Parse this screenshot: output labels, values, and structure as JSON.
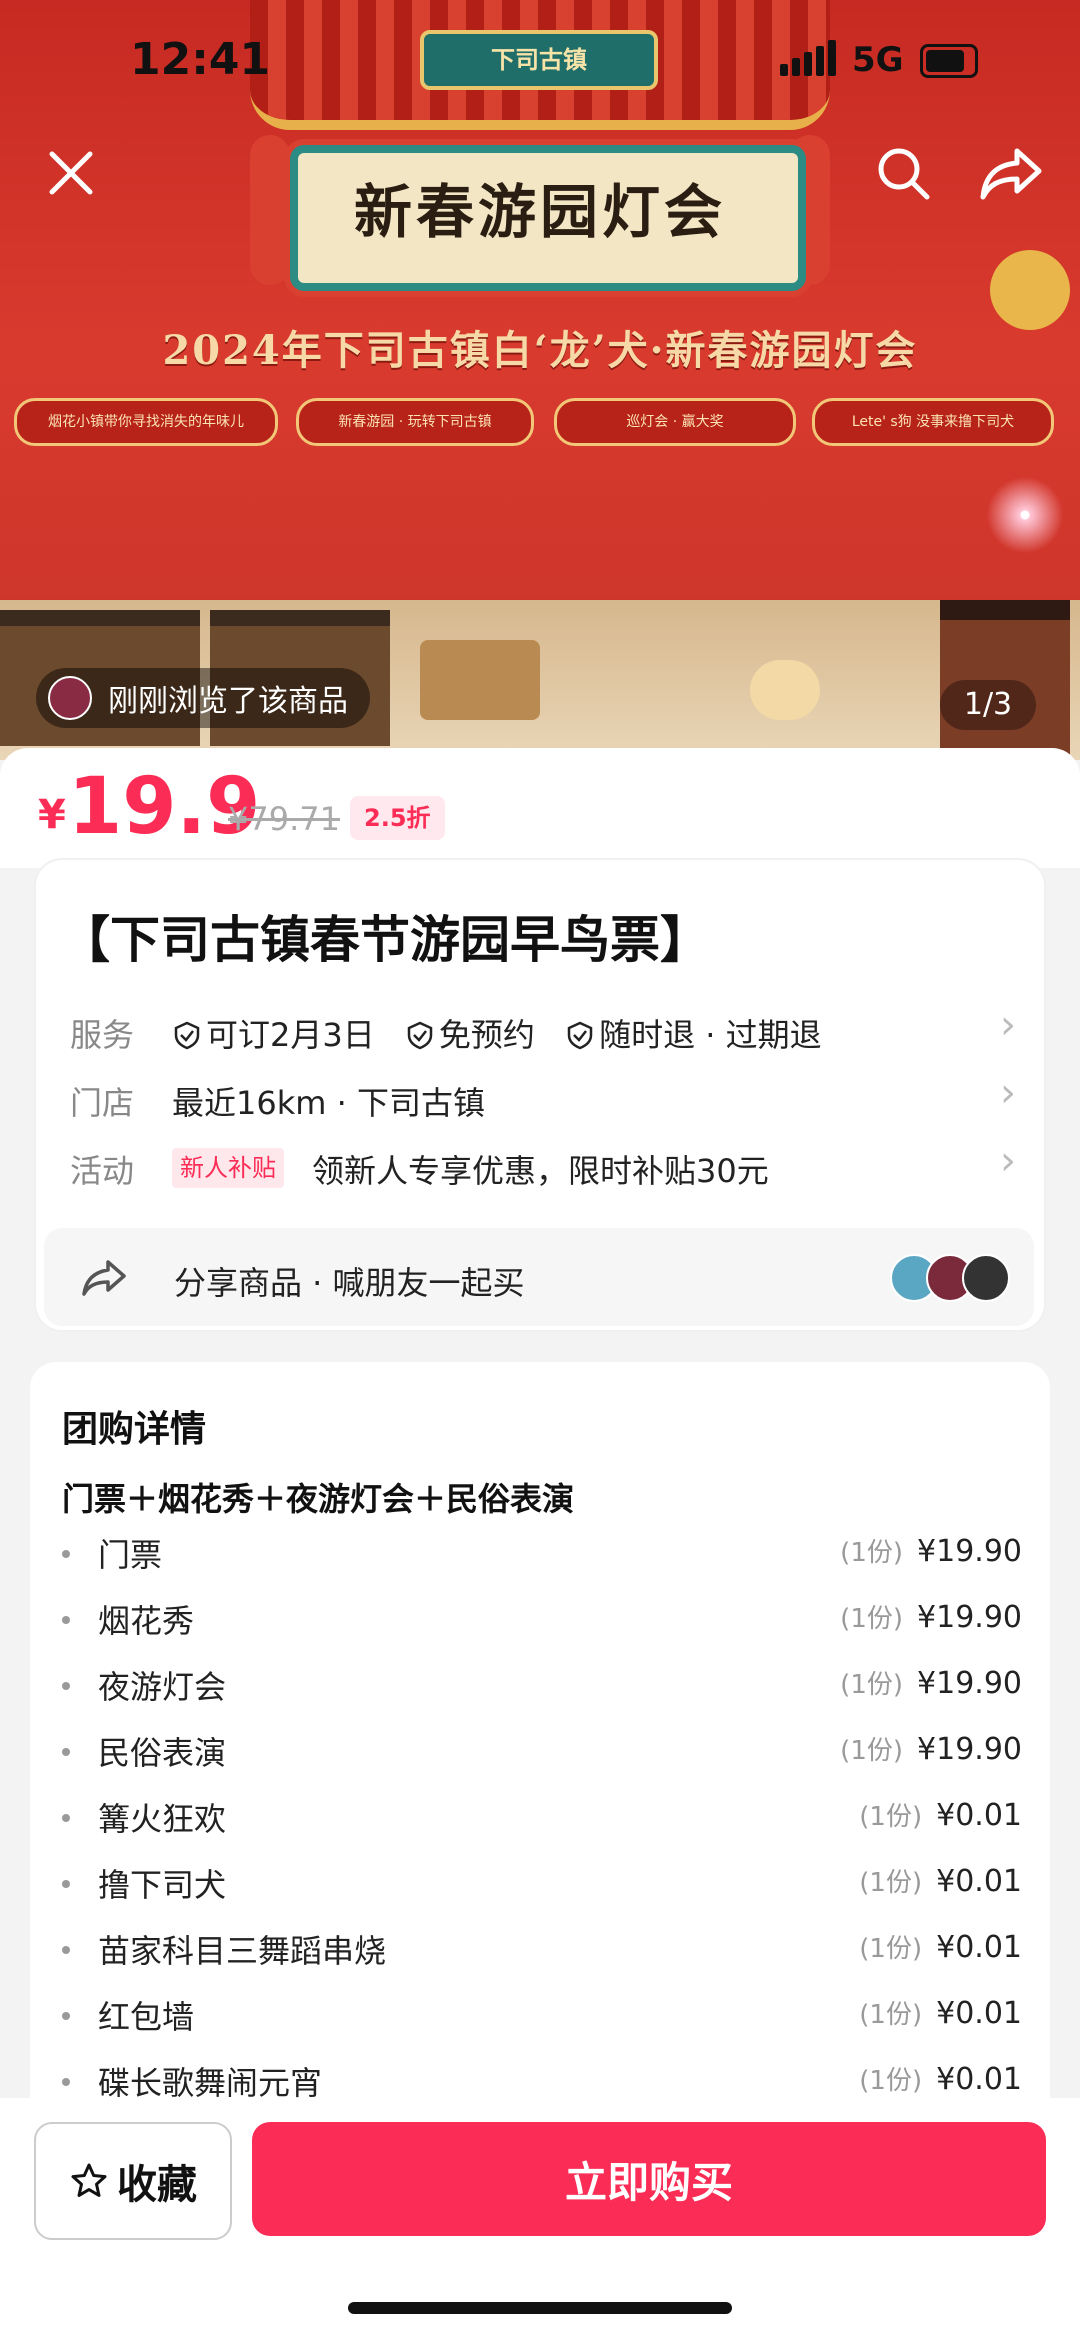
{
  "status": {
    "time": "12:41",
    "network": "5G"
  },
  "hero": {
    "sign": "下司古镇",
    "title": "新春游园灯会",
    "subtitle": "2024年下司古镇白‘龙’犬·新春游园灯会",
    "tags": [
      "烟花小镇带你寻找消失的年味儿",
      "新春游园 · 玩转下司古镇",
      "巡灯会 · 赢大奖",
      "Lete' s狗 没事来撸下司犬"
    ],
    "browsed": "刚刚浏览了该商品",
    "pager": "1/3"
  },
  "price": {
    "currency": "¥",
    "current": "19.9",
    "original": "¥79.71",
    "discount": "2.5折"
  },
  "product": {
    "title": "【下司古镇春节游园早鸟票】",
    "service_label": "服务",
    "services": [
      "可订2月3日",
      "免预约",
      "随时退 · 过期退"
    ],
    "store_label": "门店",
    "store": "最近16km · 下司古镇",
    "activity_label": "活动",
    "activity_tag": "新人补贴",
    "activity": "领新人专享优惠，限时补贴30元",
    "share": "分享商品 · 喊朋友一起买"
  },
  "details": {
    "title": "团购详情",
    "subtitle": "门票＋烟花秀＋夜游灯会＋民俗表演",
    "items": [
      {
        "name": "门票",
        "qty": "(1份)",
        "price": "¥19.90"
      },
      {
        "name": "烟花秀",
        "qty": "(1份)",
        "price": "¥19.90"
      },
      {
        "name": "夜游灯会",
        "qty": "(1份)",
        "price": "¥19.90"
      },
      {
        "name": "民俗表演",
        "qty": "(1份)",
        "price": "¥19.90"
      },
      {
        "name": "篝火狂欢",
        "qty": "(1份)",
        "price": "¥0.01"
      },
      {
        "name": "撸下司犬",
        "qty": "(1份)",
        "price": "¥0.01"
      },
      {
        "name": "苗家科目三舞蹈串烧",
        "qty": "(1份)",
        "price": "¥0.01"
      },
      {
        "name": "红包墙",
        "qty": "(1份)",
        "price": "¥0.01"
      },
      {
        "name": "碟长歌舞闹元宵",
        "qty": "(1份)",
        "price": "¥0.01"
      }
    ]
  },
  "actions": {
    "favorite": "收藏",
    "buy": "立即购买"
  },
  "colors": {
    "accent": "#fb2c55",
    "banner": "#d93a2e"
  }
}
